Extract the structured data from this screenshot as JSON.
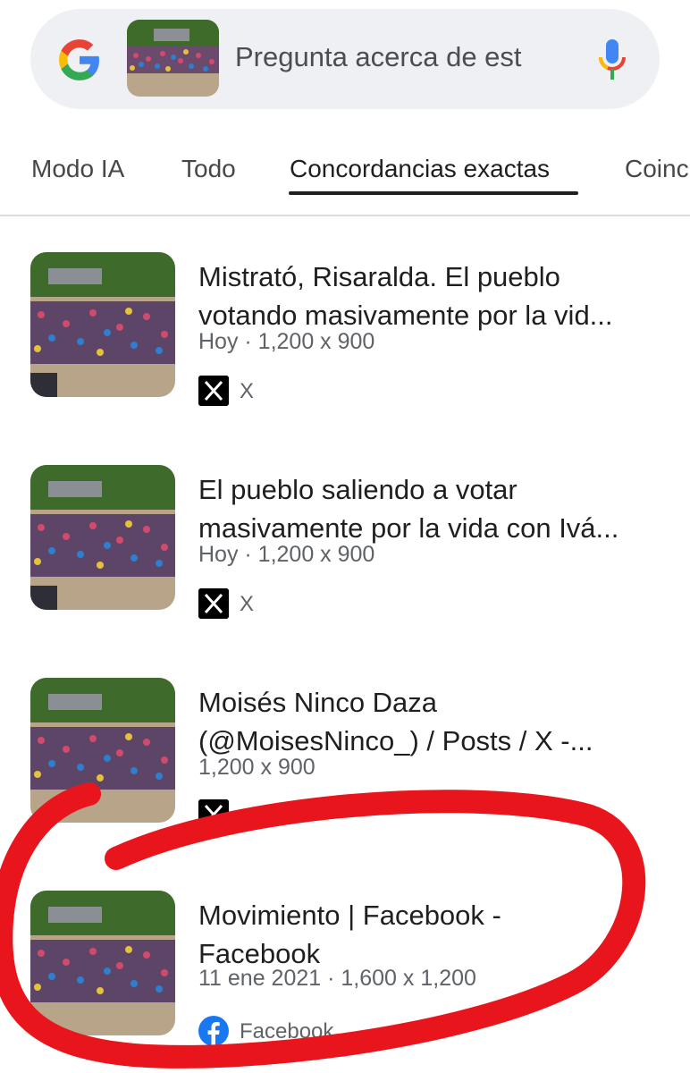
{
  "search": {
    "query_placeholder": "Pregunta acerca de est"
  },
  "icons": {
    "google": "google-g-icon",
    "mic": "mic-icon",
    "x": "x-logo-icon",
    "facebook": "facebook-icon"
  },
  "tabs": [
    {
      "label": "Modo IA"
    },
    {
      "label": "Todo"
    },
    {
      "label": "Concordancias exactas",
      "active": true
    },
    {
      "label": "Coinc"
    }
  ],
  "results": [
    {
      "title": "Mistrató, Risaralda. El pueblo\nvotando masivamente por la vid...",
      "meta": "Hoy · 1,200 x 900",
      "source": "X"
    },
    {
      "title": "El pueblo saliendo a votar\nmasivamente por la vida con Ivá...",
      "meta": "Hoy · 1,200 x 900",
      "source": "X"
    },
    {
      "title": "Moisés Ninco Daza\n(@MoisesNinco_) / Posts / X -...",
      "meta": "1,200 x 900",
      "source": ""
    },
    {
      "title": "Movimiento | Facebook -\nFacebook",
      "meta": "11 ene 2021 · 1,600 x 1,200",
      "source": "Facebook"
    }
  ],
  "colors": {
    "annotation_red": "#e8161c",
    "search_bg": "#eef0f4",
    "facebook_blue": "#1877f2"
  }
}
